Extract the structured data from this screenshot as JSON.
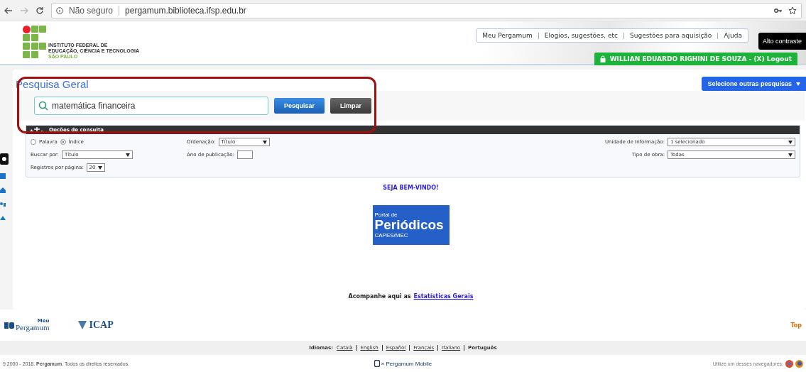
{
  "browser": {
    "security": "Não seguro",
    "url": "pergamum.biblioteca.ifsp.edu.br"
  },
  "header": {
    "logo_lines": [
      "INSTITUTO FEDERAL DE",
      "EDUCAÇÃO, CIÊNCIA E TECNOLOGIA",
      "SÃO PAULO"
    ],
    "links": [
      "Meu Pergamum",
      "Elogios, sugestões, etc",
      "Sugestões para aquisição",
      "Ajuda"
    ],
    "contrast_button": "Alto contraste",
    "user": "WILLIAN EDUARDO RIGHINI DE SOUZA - (X) Logout"
  },
  "search": {
    "title": "Pesquisa Geral",
    "query": "matemática financeira",
    "buttons": [
      {
        "label": "Pesquisar",
        "kind": "primary"
      },
      {
        "label": "Limpar",
        "kind": "secondary"
      }
    ],
    "other": "Selecione outras pesquisas"
  },
  "options": {
    "title": "Opções de consulta",
    "radios": [
      {
        "label": "Palavra",
        "selected": false
      },
      {
        "label": "Índice",
        "selected": true
      }
    ],
    "order": {
      "label": "Ordenação:",
      "value": "Título"
    },
    "search_by": {
      "label": "Buscar por:",
      "value": "Título"
    },
    "year": {
      "label": "Ano de publicação:"
    },
    "per_page": {
      "label": "Registros por página:",
      "value": "20"
    },
    "unit": {
      "label": "Unidade de Informação:",
      "value": "1 selecionado"
    },
    "type": {
      "label": "Tipo de obra:",
      "value": "Todas"
    }
  },
  "welcome": "SEJA BEM-VINDO!",
  "banner": {
    "top": "Portal de",
    "title": "Periódicos",
    "bottom": "CAPES/MEC"
  },
  "stats": {
    "text": "Acompanhe aqui as",
    "link": "Estatísticas Gerais"
  },
  "footer": {
    "pergamum_top": "Meu",
    "pergamum": "Pergamum",
    "icap": "ICAP",
    "top": "Top",
    "languages_label": "Idiomas:",
    "languages": [
      {
        "label": "Català",
        "selected": false
      },
      {
        "label": "English",
        "selected": false
      },
      {
        "label": "Español",
        "selected": false
      },
      {
        "label": "Français",
        "selected": false
      },
      {
        "label": "Italiano",
        "selected": false
      },
      {
        "label": "Português",
        "selected": true
      }
    ],
    "copyright": "9 2000 - 2018. **Pergamum**. Todos os direitos reservados.",
    "mobile": "» Pergamum Mobile",
    "browsers": "Utilize um desses navegadores:"
  }
}
